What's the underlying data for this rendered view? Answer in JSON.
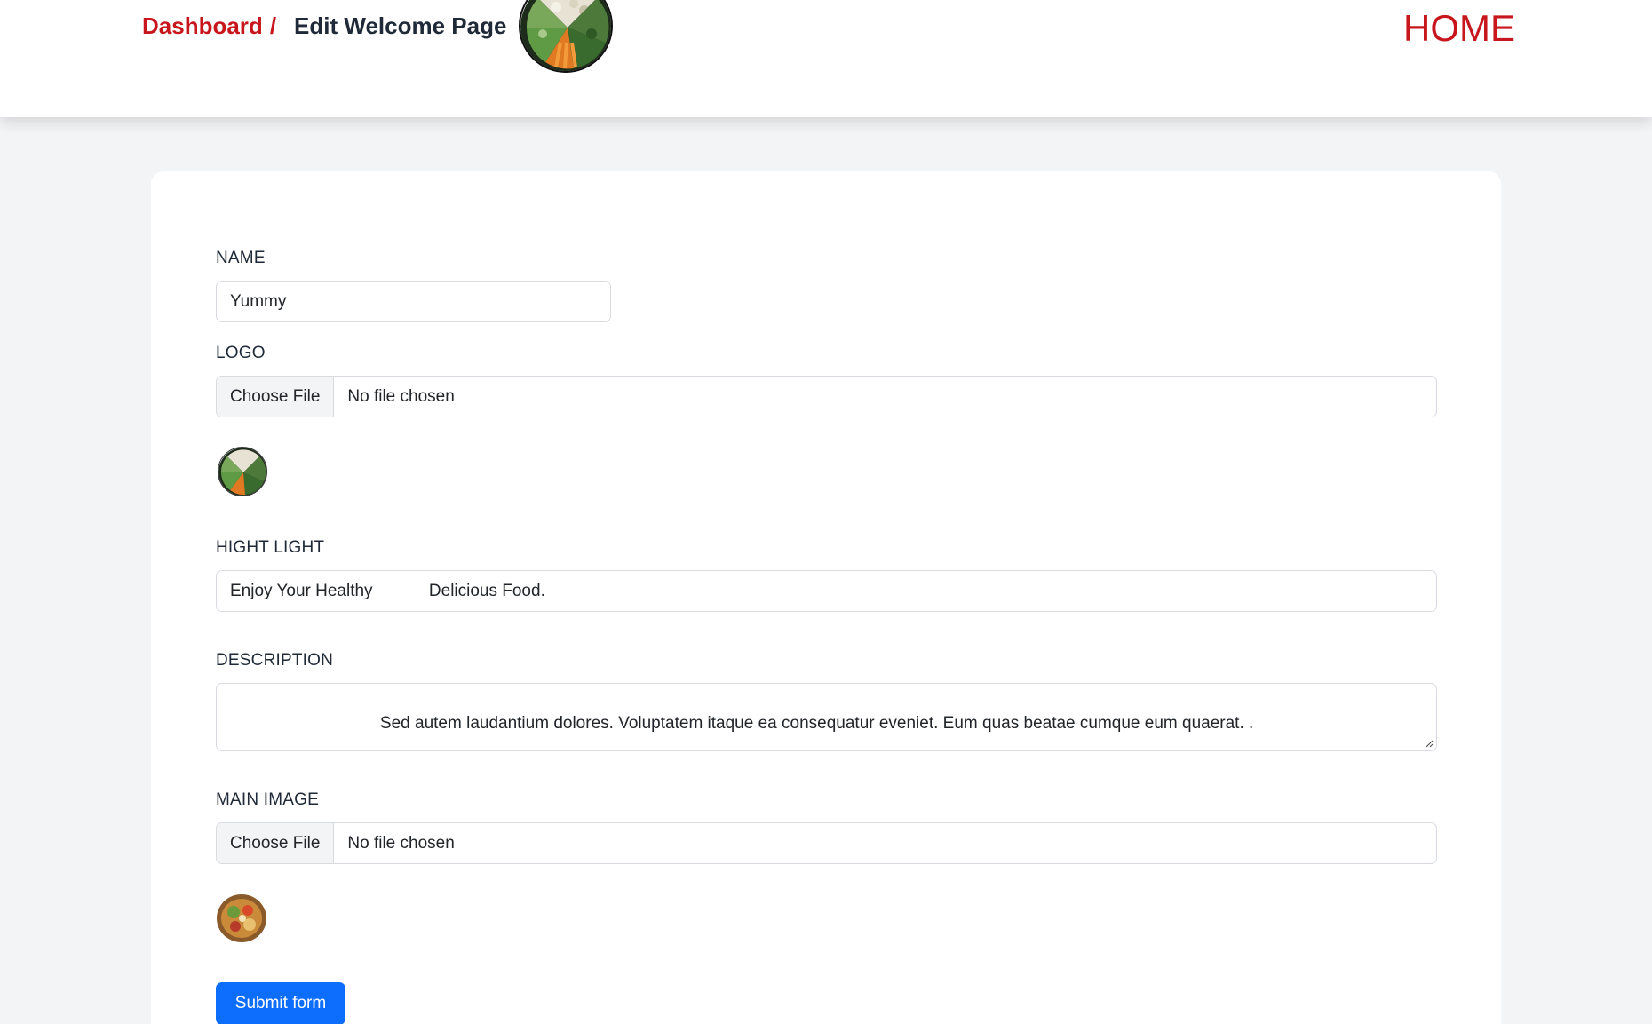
{
  "header": {
    "breadcrumb_link": "Dashboard",
    "breadcrumb_separator": "/",
    "breadcrumb_current": "Edit Welcome Page",
    "home_label": "HOME",
    "logo_icon": "food-bowl-logo-icon"
  },
  "form": {
    "name_label": "NAME",
    "name_value": "Yummy",
    "logo_label": "LOGO",
    "logo_button": "Choose File",
    "logo_status": "No file chosen",
    "logo_preview_icon": "logo-preview-thumbnail-icon",
    "highlight_label": "HIGHT LIGHT",
    "highlight_value": "Enjoy Your Healthy            Delicious Food.",
    "description_label": "DESCRIPTION",
    "description_value": "                            Sed autem laudantium dolores. Voluptatem itaque ea consequatur eveniet. Eum quas beatae cumque eum quaerat. .",
    "main_image_label": "MAIN IMAGE",
    "main_image_button": "Choose File",
    "main_image_status": "No file chosen",
    "main_image_preview_icon": "main-image-preview-thumbnail-icon",
    "submit_label": "Submit form"
  },
  "colors": {
    "accent_red": "#c8161d",
    "primary_blue": "#0d6efd",
    "page_background": "#f3f4f6"
  }
}
